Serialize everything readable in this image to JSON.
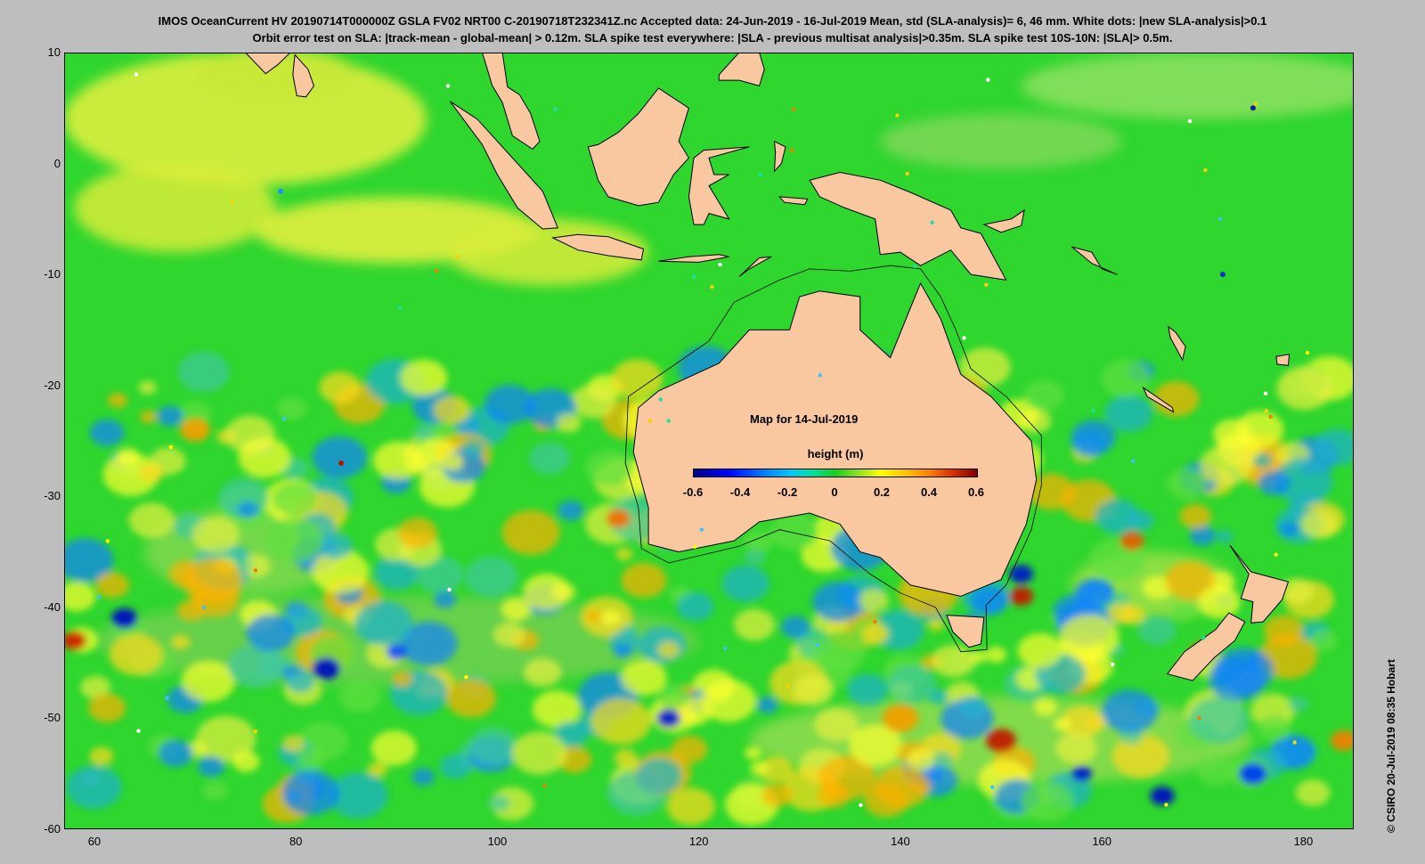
{
  "header": {
    "title_line1": "IMOS OceanCurrent HV 20190714T000000Z GSLA FV02 NRT00 C-20190718T232341Z.nc  Accepted data: 24-Jun-2019 - 16-Jul-2019 Mean, std (SLA-analysis)= 6, 46 mm. White dots: |new SLA-analysis|>0.1",
    "title_line2": "Orbit error test on SLA: |track-mean  - global-mean| > 0.12m.  SLA spike test everywhere: |SLA - previous multisat analysis|>0.35m. SLA spike test 10S-10N: |SLA|> 0.5m."
  },
  "map": {
    "date_label": "Map for 14-Jul-2019",
    "lon_range": [
      57,
      185
    ],
    "lat_range": [
      -60,
      10
    ],
    "x_ticks": [
      "60",
      "80",
      "100",
      "120",
      "140",
      "160",
      "180"
    ],
    "y_ticks": [
      "10",
      "0",
      "-10",
      "-20",
      "-30",
      "-40",
      "-50",
      "-60"
    ],
    "land_color": "#f9c8a0",
    "ocean_base_color": "#2ed62e"
  },
  "colorbar": {
    "title": "height (m)",
    "ticks": [
      "-0.6",
      "-0.4",
      "-0.2",
      "0",
      "0.2",
      "0.4",
      "0.6"
    ],
    "range": [
      -0.6,
      0.6
    ]
  },
  "credit": "© CSIRO 20-Jul-2019 08:35 Hobart"
}
